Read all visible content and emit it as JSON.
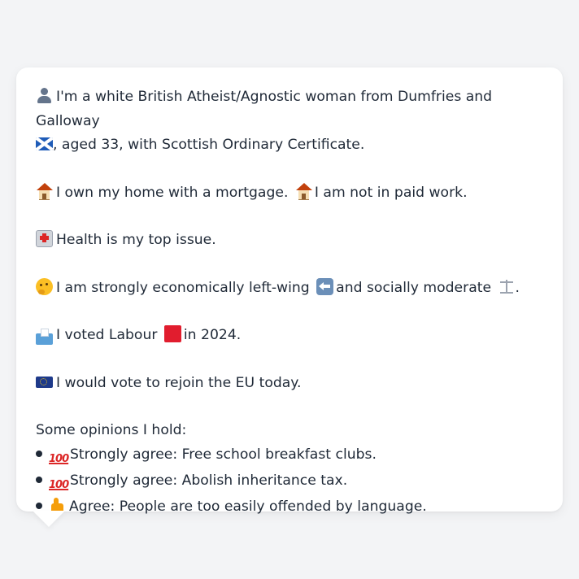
{
  "profile": {
    "intro": {
      "line1_text": "I'm a white British Atheist/Agnostic woman from Dumfries and Galloway",
      "line2_text": ", aged 33, with Scottish Ordinary Certificate.",
      "icon_person": "person-silhouette-icon",
      "icon_flag": "scotland-flag-icon"
    },
    "housing": {
      "text1": "I own my home with a mortgage.",
      "text2": "I am not in paid work.",
      "icon": "house-icon"
    },
    "issue": {
      "text": "Health is my top issue.",
      "icon": "hospital-icon"
    },
    "ideology": {
      "text1": "I am strongly economically left-wing",
      "text2": "and socially moderate",
      "text3": ".",
      "icon_face": "thinking-face-icon",
      "icon_left": "left-arrow-icon",
      "icon_scales": "balance-scale-icon"
    },
    "vote": {
      "text1": "I voted Labour",
      "text2": "in 2024.",
      "icon_ballot": "ballot-box-icon",
      "icon_party": "red-square-icon",
      "party_color": "#e11d2e"
    },
    "eu": {
      "text": "I would vote to rejoin the EU today.",
      "icon": "eu-flag-icon"
    },
    "opinions": {
      "heading": "Some opinions I hold:",
      "items": [
        {
          "label": "Strongly agree: Free school breakfast clubs.",
          "icon": "hundred-points-icon"
        },
        {
          "label": "Strongly agree: Abolish inheritance tax.",
          "icon": "hundred-points-icon"
        },
        {
          "label": "Agree: People are too easily offended by language.",
          "icon": "thumbs-up-icon"
        }
      ],
      "hundred_glyph": "100"
    }
  },
  "colors": {
    "background": "#f3f4f6",
    "bubble": "#ffffff",
    "text": "#1f2937"
  }
}
